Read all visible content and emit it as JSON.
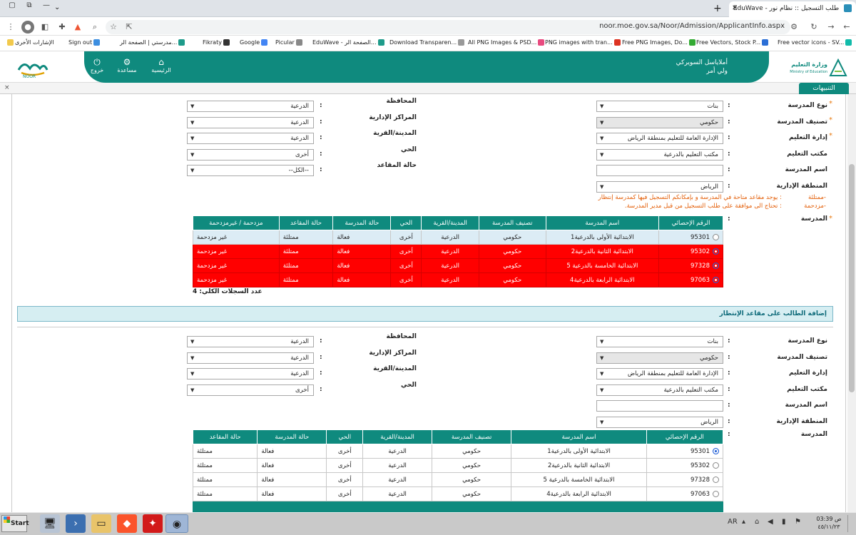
{
  "browser": {
    "tab_title": "طلب التسجيل :: نظام نور - EduWave",
    "url": "noor.moe.gov.sa/Noor/Admission/ApplicantInfo.aspx",
    "bookmarks": [
      "الإشارات الأخرى",
      "Sign out",
      "مدرستي | الصفحة الر...",
      "Fikraty",
      "Google",
      "Picular",
      "EduWave - الصفحة الر...",
      "Download Transparen...",
      "All PNG Images & PSD...",
      "PNG images with tran...",
      "Free PNG Images, Do...",
      "Free Vectors, Stock P...",
      "Free vector icons - SV..."
    ]
  },
  "header": {
    "nav": [
      {
        "label": "خروج",
        "icon": "power-icon"
      },
      {
        "label": "مساعدة",
        "icon": "gear-icon"
      },
      {
        "label": "الرئيسية",
        "icon": "home-icon"
      }
    ],
    "user_name": "أملاياسل السويركي",
    "user_role": "ولي أمر",
    "noor_caption": "NOOR",
    "ministry_name": "وزارة التعليم",
    "ministry_sub": "Ministry of Education"
  },
  "alerts": {
    "tab_label": "التنبيهات",
    "close": "×"
  },
  "form1": {
    "right": [
      {
        "label": "نوع المدرسة",
        "value": "بنات",
        "required": true,
        "disabled": false,
        "kind": "select"
      },
      {
        "label": "تصنيف المدرسة",
        "value": "حكومي",
        "required": true,
        "disabled": true,
        "kind": "select"
      },
      {
        "label": "إدارة التعليم",
        "value": "الإدارة العامة للتعليم بمنطقة الرياض",
        "required": true,
        "disabled": false,
        "kind": "select"
      },
      {
        "label": "مكتب التعليم",
        "value": "مكتب التعليم بالدرعية",
        "required": false,
        "disabled": false,
        "kind": "select"
      },
      {
        "label": "اسم المدرسة",
        "value": "",
        "required": false,
        "disabled": false,
        "kind": "input"
      },
      {
        "label": "المنطقة الإدارية",
        "value": "الرياض",
        "required": false,
        "disabled": false,
        "kind": "select"
      }
    ],
    "left": [
      {
        "label": "المحافظة",
        "value": "الدرعية"
      },
      {
        "label": "المراكز الإدارية",
        "value": "الدرعية"
      },
      {
        "label": "المدينة/القرية",
        "value": "الدرعية"
      },
      {
        "label": "الحي",
        "value": "أخرى"
      },
      {
        "label": "حالة المقاعد",
        "value": "--الكل--"
      }
    ],
    "notes": [
      {
        "key": "-ممتلئة",
        "text": ": يوجد مقاعد متاحة في المدرسة و بإمكانكم التسجيل فيها كمدرسة إنتظار"
      },
      {
        "key": "-مزدحمة",
        "text": ": تحتاج الى موافقة على طلب التسجيل من قبل مدير المدرسة."
      }
    ],
    "school_label": "المدرسة",
    "columns": [
      "الرقم الإحصائي",
      "اسم المدرسة",
      "تصنيف المدرسة",
      "المدينة/القرية",
      "الحي",
      "حالة المدرسة",
      "حالة المقاعد",
      "مزدحمة / غيرمزدحمة"
    ],
    "rows": [
      {
        "id": "95301",
        "name": "الابتدائية الأولى بالدرعية1",
        "type": "حكومي",
        "city": "الدرعية",
        "district": "أخرى",
        "status": "فعالة",
        "seats": "ممتلئة",
        "crowd": "غير مزدحمة",
        "style": "selected"
      },
      {
        "id": "95302",
        "name": "الابتدائية الثانية بالدرعية2",
        "type": "حكومي",
        "city": "الدرعية",
        "district": "أخرى",
        "status": "فعالة",
        "seats": "ممتلئة",
        "crowd": "غير مزدحمة",
        "style": "red"
      },
      {
        "id": "97328",
        "name": "الابتدائية الخامسة بالدرعية 5",
        "type": "حكومي",
        "city": "الدرعية",
        "district": "أخرى",
        "status": "فعالة",
        "seats": "ممتلئة",
        "crowd": "غير مزدحمة",
        "style": "red"
      },
      {
        "id": "97063",
        "name": "الابتدائية الرابعة بالدرعية4",
        "type": "حكومي",
        "city": "الدرعية",
        "district": "أخرى",
        "status": "فعالة",
        "seats": "ممتلئة",
        "crowd": "غير مزدحمة",
        "style": "red"
      }
    ],
    "count_label": "عدد السجلات الكلي: 4"
  },
  "waitlist_label": "إضافة الطالب على مقاعد الإنتظار",
  "form2": {
    "right": [
      {
        "label": "نوع المدرسة",
        "value": "بنات",
        "disabled": false,
        "kind": "select"
      },
      {
        "label": "تصنيف المدرسة",
        "value": "حكومي",
        "disabled": true,
        "kind": "select"
      },
      {
        "label": "إدارة التعليم",
        "value": "الإدارة العامة للتعليم بمنطقة الرياض",
        "disabled": false,
        "kind": "select"
      },
      {
        "label": "مكتب التعليم",
        "value": "مكتب التعليم بالدرعية",
        "disabled": false,
        "kind": "select"
      },
      {
        "label": "اسم المدرسة",
        "value": "",
        "disabled": false,
        "kind": "input"
      },
      {
        "label": "المنطقة الإدارية",
        "value": "الرياض",
        "disabled": false,
        "kind": "select"
      }
    ],
    "left": [
      {
        "label": "المحافظة",
        "value": "الدرعية"
      },
      {
        "label": "المراكز الإدارية",
        "value": "الدرعية"
      },
      {
        "label": "المدينة/القرية",
        "value": "الدرعية"
      },
      {
        "label": "الحي",
        "value": "أخرى"
      }
    ],
    "school_label": "المدرسة",
    "columns": [
      "الرقم الإحصائي",
      "اسم المدرسة",
      "تصنيف المدرسة",
      "المدينة/القرية",
      "الحي",
      "حالة المدرسة",
      "حالة المقاعد"
    ],
    "rows": [
      {
        "id": "95301",
        "name": "الابتدائية الأولى بالدرعية1",
        "type": "حكومي",
        "city": "الدرعية",
        "district": "أخرى",
        "status": "فعالة",
        "seats": "ممتلئة",
        "checked": true
      },
      {
        "id": "95302",
        "name": "الابتدائية الثانية بالدرعية2",
        "type": "حكومي",
        "city": "الدرعية",
        "district": "أخرى",
        "status": "فعالة",
        "seats": "ممتلئة",
        "checked": false
      },
      {
        "id": "97328",
        "name": "الابتدائية الخامسة بالدرعية 5",
        "type": "حكومي",
        "city": "الدرعية",
        "district": "أخرى",
        "status": "فعالة",
        "seats": "ممتلئة",
        "checked": false
      },
      {
        "id": "97063",
        "name": "الابتدائية الرابعة بالدرعية4",
        "type": "حكومي",
        "city": "الدرعية",
        "district": "أخرى",
        "status": "فعالة",
        "seats": "ممتلئة",
        "checked": false
      }
    ]
  },
  "taskbar": {
    "start": "Start",
    "lang": "AR",
    "time": "03:39 ص",
    "date": "٤٥/١١/٢٣"
  },
  "colors": {
    "primary": "#0f8a7e",
    "alert_row": "#ff0000",
    "note": "#e35d06"
  }
}
